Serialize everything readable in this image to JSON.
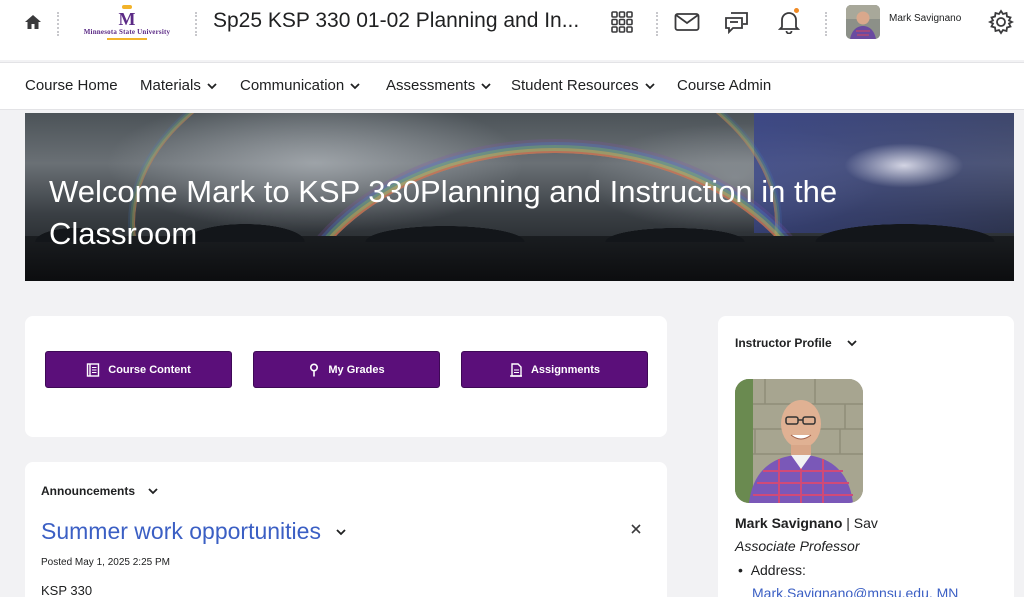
{
  "header": {
    "logo_text": "Minnesota State University",
    "logo_mark": "M",
    "course_title": "Sp25 KSP 330 01-02 Planning and In...",
    "user_name": "Mark Savignano",
    "icons": [
      "home-icon",
      "apps-grid-icon",
      "mail-icon",
      "chat-icon",
      "bell-icon",
      "gear-icon"
    ],
    "notification_color": "#f08a24"
  },
  "nav": {
    "items": [
      {
        "label": "Course Home",
        "dropdown": false
      },
      {
        "label": "Materials",
        "dropdown": true
      },
      {
        "label": "Communication",
        "dropdown": true
      },
      {
        "label": "Assessments",
        "dropdown": true
      },
      {
        "label": "Student Resources",
        "dropdown": true
      },
      {
        "label": "Course Admin",
        "dropdown": false
      }
    ]
  },
  "banner": {
    "title": "Welcome Mark to KSP 330Planning and Instruction in the Classroom"
  },
  "quick_links": {
    "accent": "#5b0f7a",
    "buttons": [
      {
        "label": "Course Content",
        "icon": "book-icon"
      },
      {
        "label": "My Grades",
        "icon": "pin-icon"
      },
      {
        "label": "Assignments",
        "icon": "document-icon"
      }
    ]
  },
  "announcements": {
    "heading": "Announcements",
    "item_title": "Summer work opportunities",
    "posted": "Posted May 1, 2025 2:25 PM",
    "body": "KSP 330",
    "link_color": "#3b5fc4"
  },
  "profile": {
    "heading": "Instructor Profile",
    "name": "Mark Savignano",
    "name_suffix": " | Sav",
    "role": "Associate Professor",
    "address_label": "Address:",
    "email": "Mark.Savignano@mnsu.edu, MN"
  }
}
